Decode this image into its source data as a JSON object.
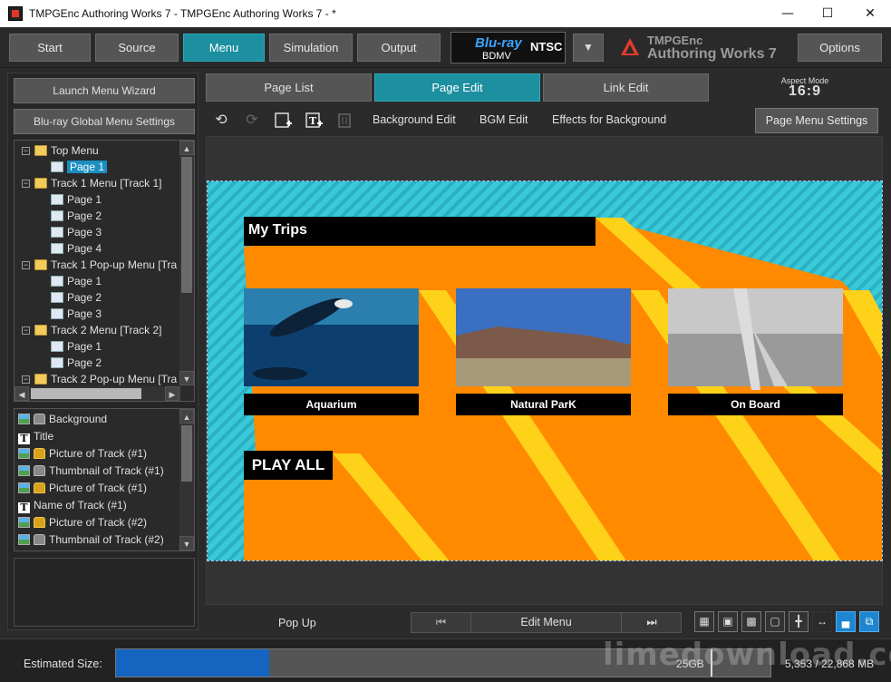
{
  "window": {
    "title": "TMPGEnc Authoring Works 7 - TMPGEnc Authoring Works 7 - *"
  },
  "main_toolbar": {
    "buttons": [
      "Start",
      "Source",
      "Menu",
      "Simulation",
      "Output"
    ],
    "active": "Menu",
    "disc_badge": {
      "logo": "Blu-ray",
      "format": "BDMV",
      "standard": "NTSC"
    },
    "brand_line1": "TMPGEnc",
    "brand_line2": "Authoring Works 7",
    "options_label": "Options"
  },
  "left_panel": {
    "wizard_label": "Launch Menu Wizard",
    "global_settings_label": "Blu-ray Global Menu Settings",
    "tree": [
      {
        "label": "Top Menu",
        "type": "folder",
        "level": 0
      },
      {
        "label": "Page 1",
        "type": "page",
        "level": 1,
        "selected": true
      },
      {
        "label": "Track 1 Menu [Track 1]",
        "type": "folder",
        "level": 0
      },
      {
        "label": "Page 1",
        "type": "page",
        "level": 1
      },
      {
        "label": "Page 2",
        "type": "page",
        "level": 1
      },
      {
        "label": "Page 3",
        "type": "page",
        "level": 1
      },
      {
        "label": "Page 4",
        "type": "page",
        "level": 1
      },
      {
        "label": "Track 1 Pop-up Menu [Tra",
        "type": "folder",
        "level": 0
      },
      {
        "label": "Page 1",
        "type": "page",
        "level": 1
      },
      {
        "label": "Page 2",
        "type": "page",
        "level": 1
      },
      {
        "label": "Page 3",
        "type": "page",
        "level": 1
      },
      {
        "label": "Track 2 Menu [Track 2]",
        "type": "folder",
        "level": 0
      },
      {
        "label": "Page 1",
        "type": "page",
        "level": 1
      },
      {
        "label": "Page 2",
        "type": "page",
        "level": 1
      },
      {
        "label": "Track 2 Pop-up Menu [Tra",
        "type": "folder",
        "level": 0
      }
    ],
    "layers": [
      {
        "label": "Background",
        "icons": [
          "image",
          "lock-gray"
        ]
      },
      {
        "label": "Title",
        "icons": [
          "text"
        ]
      },
      {
        "label": "Picture of Track (#1)",
        "icons": [
          "image",
          "lock-gold"
        ]
      },
      {
        "label": "Thumbnail of Track (#1)",
        "icons": [
          "image",
          "lock-gray"
        ]
      },
      {
        "label": "Picture of Track (#1)",
        "icons": [
          "image",
          "lock-gold"
        ]
      },
      {
        "label": "Name of Track (#1)",
        "icons": [
          "text"
        ]
      },
      {
        "label": "Picture of Track (#2)",
        "icons": [
          "image",
          "lock-gold"
        ]
      },
      {
        "label": "Thumbnail of Track (#2)",
        "icons": [
          "image",
          "lock-gray"
        ]
      }
    ]
  },
  "tabs": {
    "items": [
      "Page List",
      "Page Edit",
      "Link Edit"
    ],
    "active": "Page Edit"
  },
  "aspect": {
    "label": "Aspect Mode",
    "value": "16:9"
  },
  "edit_toolbar": {
    "background_edit": "Background Edit",
    "bgm_edit": "BGM Edit",
    "effects_background": "Effects for Background",
    "page_menu_settings": "Page Menu Settings"
  },
  "menu_canvas": {
    "title": "My Trips",
    "items": [
      {
        "caption": "Aquarium"
      },
      {
        "caption": "Natural ParK"
      },
      {
        "caption": "On Board"
      }
    ],
    "play_all": "PLAY ALL",
    "colors": {
      "background": "#33c7d6",
      "stripe_orange": "#ff8800",
      "stripe_yellow": "#ffd500",
      "label_bg": "#000000"
    }
  },
  "bottom_bar": {
    "popup_label": "Pop Up",
    "edit_menu_label": "Edit Menu",
    "prev_icon": "skip-back-icon",
    "next_icon": "skip-forward-icon"
  },
  "status": {
    "estimated_label": "Estimated Size:",
    "capacity_label": "25GB",
    "size_values": "5,353 / 22,868 MB",
    "fill_fraction": 0.2341
  },
  "watermark": "limedownload.com"
}
